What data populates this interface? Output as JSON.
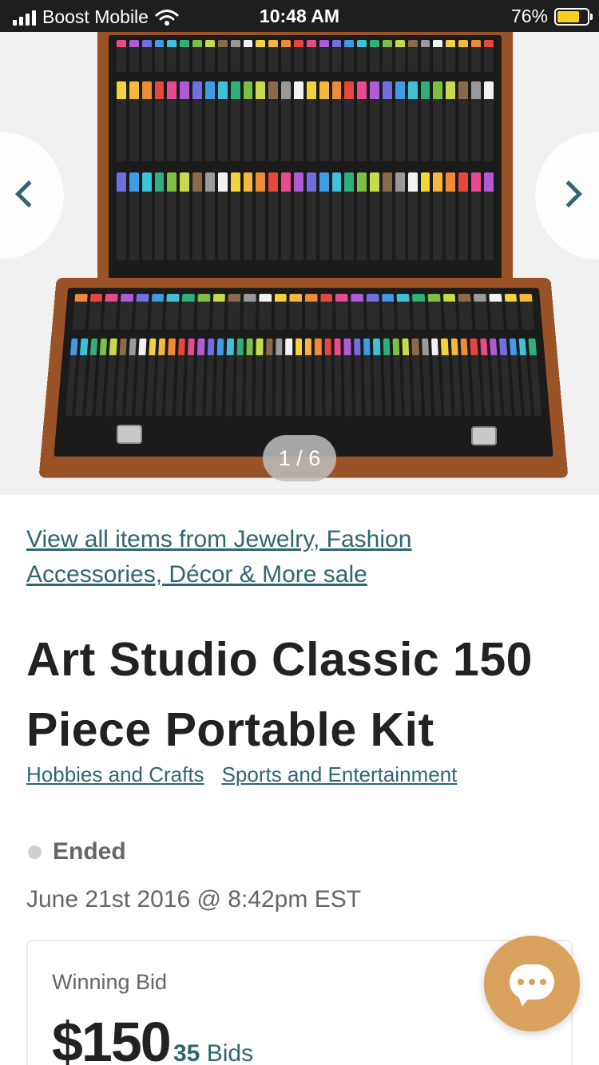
{
  "status_bar": {
    "carrier": "Boost Mobile",
    "time": "10:48 AM",
    "battery": "76%",
    "battery_level": 0.76
  },
  "gallery": {
    "counter": "1 / 6",
    "prev_icon": "chevron-left-icon",
    "next_icon": "chevron-right-icon",
    "image": "art-kit-photo"
  },
  "sale_link": "View all items from Jewelry, Fashion Accessories, Décor & More sale",
  "item": {
    "title": "Art Studio Classic 150 Piece Portable Kit",
    "categories": [
      "Hobbies and Crafts",
      "Sports and Entertainment"
    ],
    "status": "Ended",
    "ended_at": "June 21st 2016 @ 8:42pm EST"
  },
  "bid": {
    "label": "Winning Bid",
    "amount": "$150",
    "count": "35",
    "count_label": "Bids"
  },
  "chat": {
    "icon": "chat-bubble-icon"
  },
  "colors": {
    "accent": "#2f6670",
    "fab": "#d8a15d",
    "status_bar": "#1e1e1e"
  }
}
